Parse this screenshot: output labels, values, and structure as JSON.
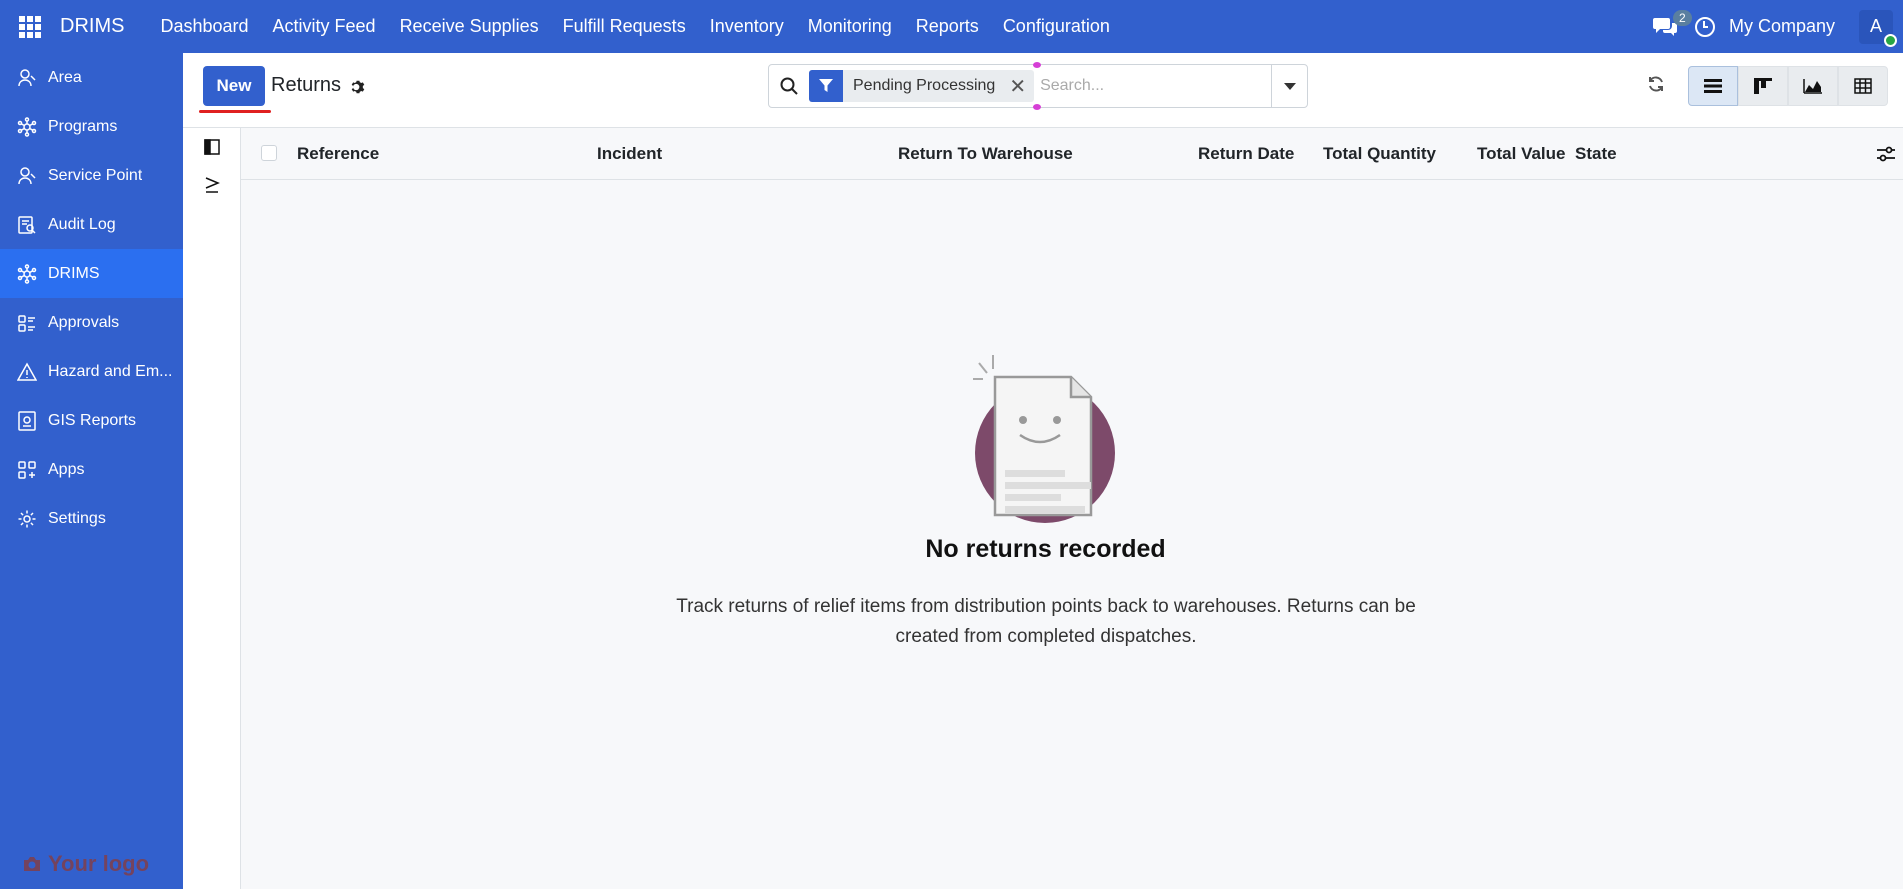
{
  "navbar": {
    "brand": "DRIMS",
    "menu": [
      "Dashboard",
      "Activity Feed",
      "Receive Supplies",
      "Fulfill Requests",
      "Inventory",
      "Monitoring",
      "Reports",
      "Configuration"
    ],
    "chat_count": "2",
    "company": "My Company",
    "avatar_initial": "A",
    "bg_color": "#3260cd"
  },
  "sidebar": {
    "items": [
      {
        "label": "Area",
        "icon": "wrench-user-icon"
      },
      {
        "label": "Programs",
        "icon": "network-icon"
      },
      {
        "label": "Service Point",
        "icon": "wrench-user-icon"
      },
      {
        "label": "Audit Log",
        "icon": "audit-log-icon"
      },
      {
        "label": "DRIMS",
        "icon": "network-icon",
        "active": true
      },
      {
        "label": "Approvals",
        "icon": "approvals-icon"
      },
      {
        "label": "Hazard and Em...",
        "icon": "warning-triangle-icon"
      },
      {
        "label": "GIS Reports",
        "icon": "gis-report-icon"
      },
      {
        "label": "Apps",
        "icon": "apps-grid-plus-icon"
      },
      {
        "label": "Settings",
        "icon": "gear-icon"
      }
    ],
    "logo_text": "Your logo"
  },
  "control_panel": {
    "new_label": "New",
    "title": "Returns",
    "facet_label": "Pending Processing",
    "search_placeholder": "Search..."
  },
  "list": {
    "columns": [
      "Reference",
      "Incident",
      "Return To Warehouse",
      "Return Date",
      "Total Quantity",
      "Total Value",
      "State"
    ]
  },
  "empty_state": {
    "title": "No returns recorded",
    "text": "Track returns of relief items from distribution points back to warehouses. Returns can be created from completed dispatches."
  }
}
